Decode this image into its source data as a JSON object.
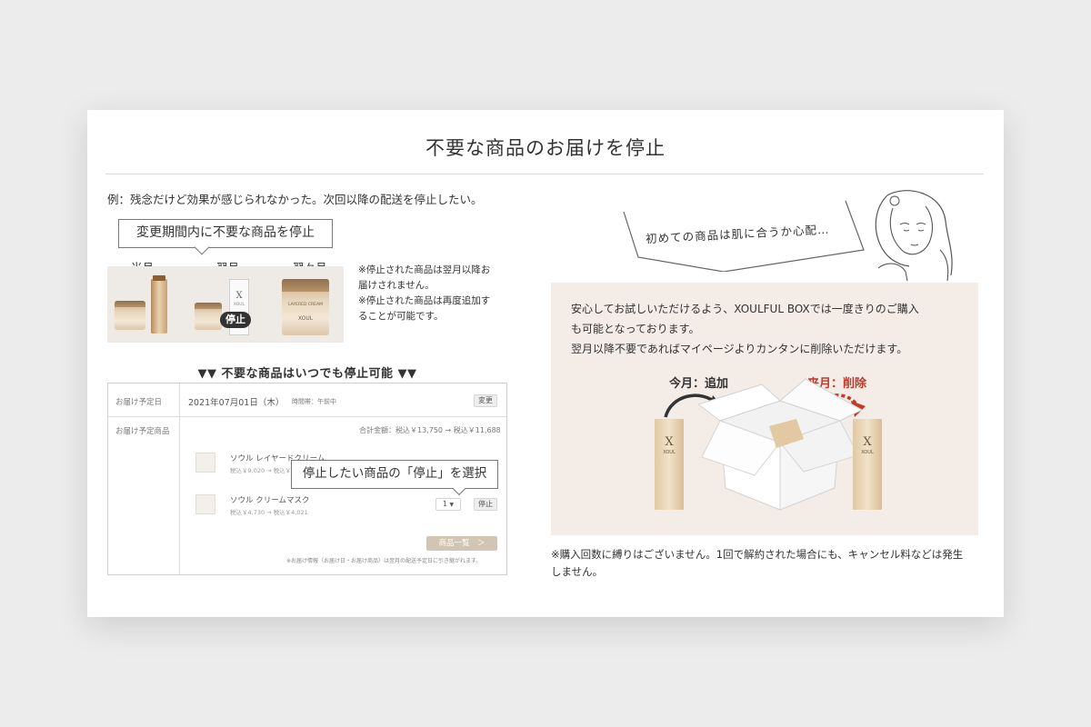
{
  "title": "不要な商品のお届けを停止",
  "example_text": "例：残念だけど効果が感じられなかった。次回以降の配送を停止したい。",
  "left": {
    "bubble_label": "変更期間内に不要な商品を停止",
    "months": [
      "当月",
      "翌月",
      "翌々月"
    ],
    "stop_badge": "停止",
    "product_mark": "X",
    "product_brand": "XOUL",
    "jar_label": "LAYERED CREAM",
    "notes": [
      "※停止された商品は翌月以降お",
      "届けされません。",
      "※停止された商品は再度追加す",
      "ることが可能です。"
    ],
    "subhead": "▼▼ 不要な商品はいつでも停止可能 ▼▼"
  },
  "table": {
    "row1_label": "お届け予定日",
    "row1_value": "2021年07月01日（木）",
    "row1_time": "時間帯：午前中",
    "change_button": "変更",
    "row2_label": "お届け予定商品",
    "total": "合計金額：税込￥13,750 → 税込￥11,688",
    "items": [
      {
        "name": "ソウル レイヤードクリーム",
        "price": "税込￥9,020 → 税込￥7,667"
      },
      {
        "name": "ソウル クリームマスク",
        "price": "税込￥4,730 → 税込￥4,021"
      }
    ],
    "qty": "1",
    "stop_button": "停止",
    "product_list_button": "商品一覧　＞",
    "footnote": "※お届け情報（お届け日・お届け商品）は翌月の配送予定日に引き継がれます。",
    "callout": "停止したい商品の「停止」を選択"
  },
  "right": {
    "thought": "初めての商品は肌に合うか心配…",
    "description": [
      "安心してお試しいただけるよう、XOULFUL BOXでは一度きりのご購入",
      "も可能となっております。",
      "翌月以降不要であればマイページよりカンタンに削除いただけます。"
    ],
    "label_add": "今月：追加",
    "label_delete": "来月：削除",
    "product_mark": "X",
    "product_brand": "XOUL",
    "bottom_note": [
      "※購入回数に縛りはございません。1回で解約された場合にも、キャンセル料などは発生",
      "しません。"
    ]
  },
  "colors": {
    "accent_red": "#c0392b",
    "panel_beige": "#f3ece7",
    "gold": "#d2c5b3"
  }
}
